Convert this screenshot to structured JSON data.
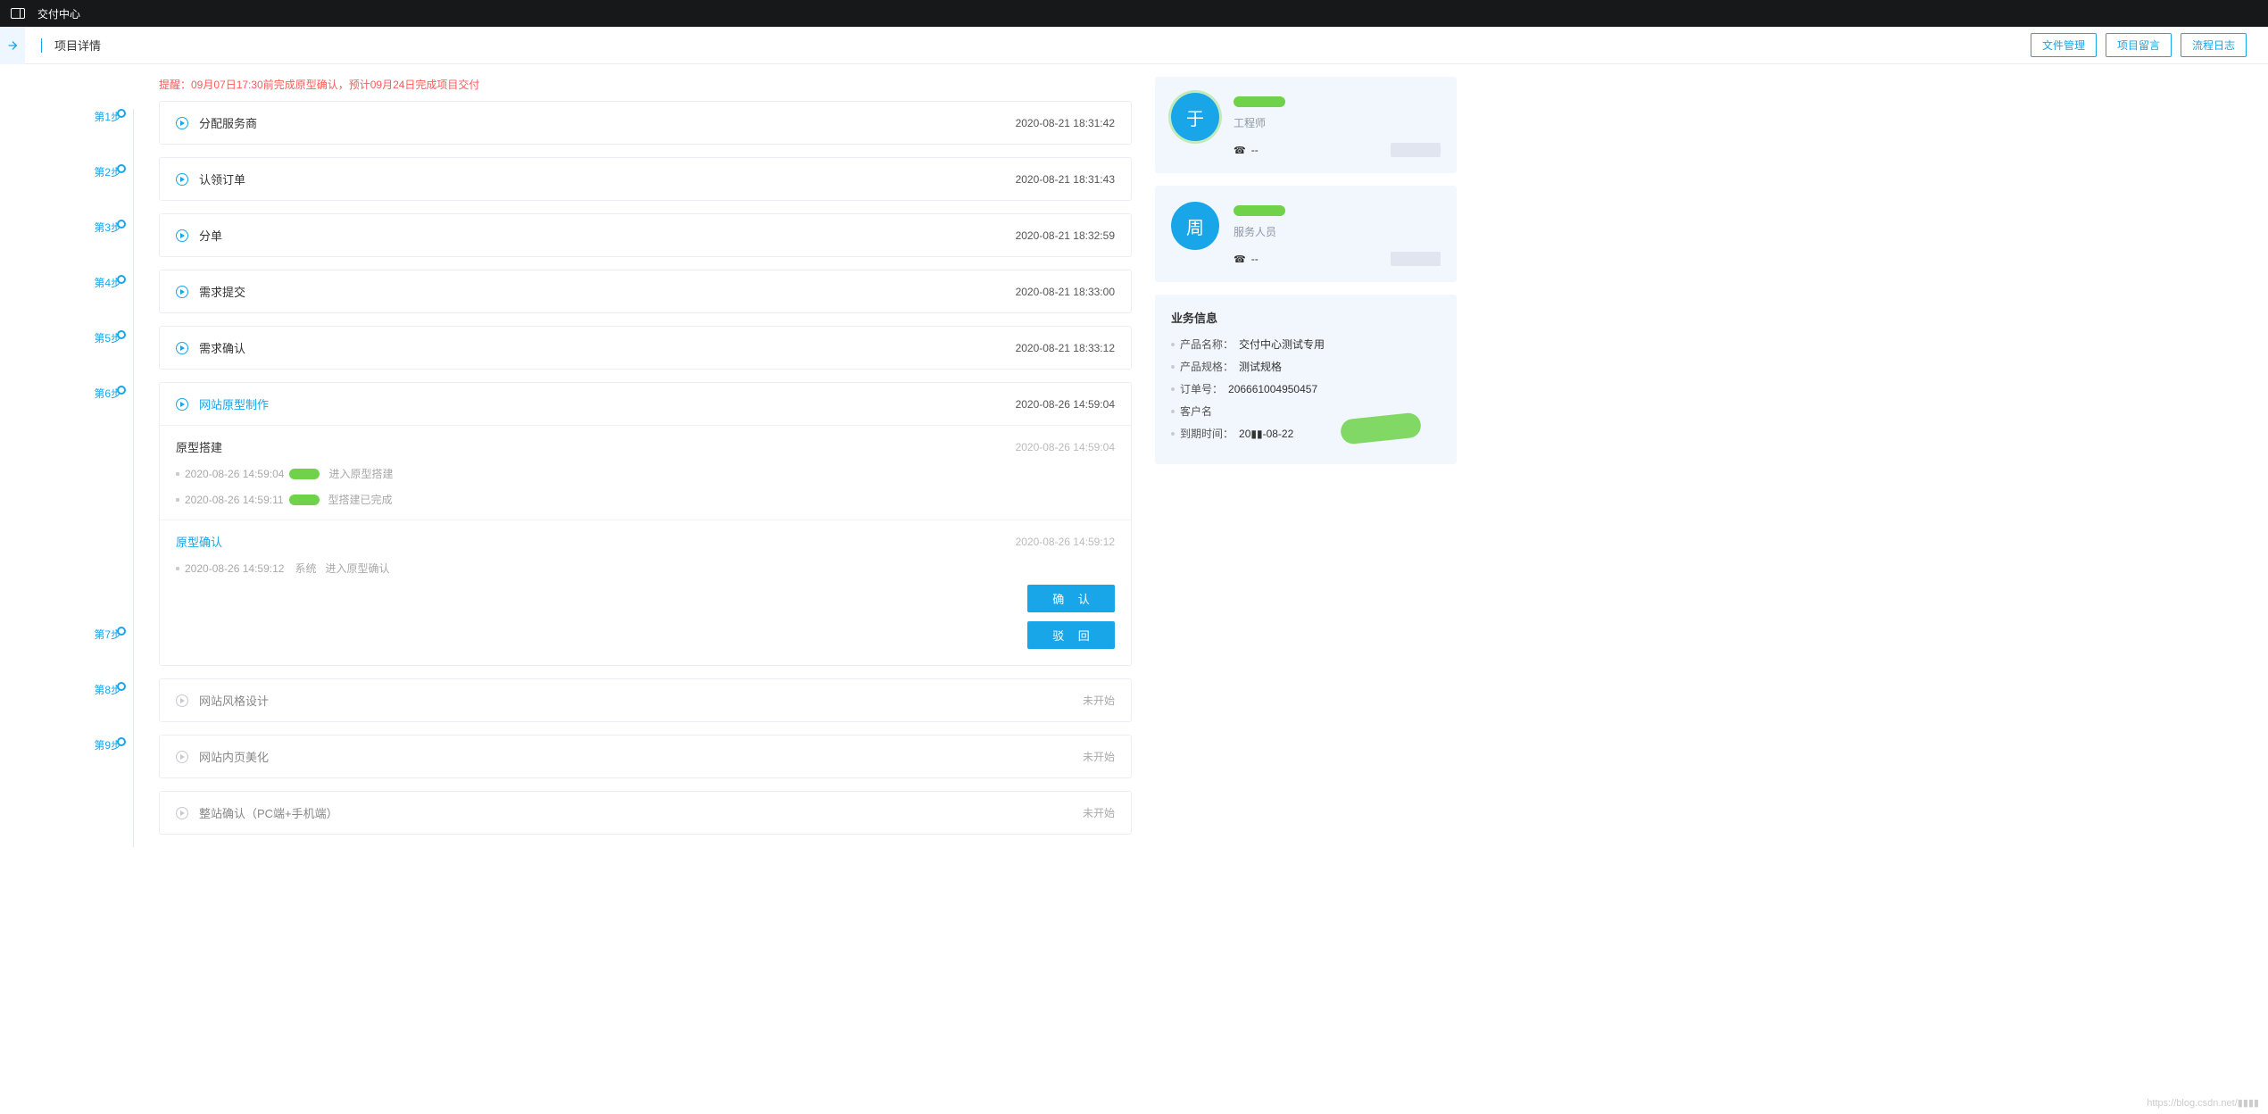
{
  "header": {
    "app_title": "交付中心",
    "page_title": "项目详情"
  },
  "actions": {
    "file_mgmt": "文件管理",
    "project_msg": "项目留言",
    "flow_log": "流程日志"
  },
  "reminder": "提醒：09月07日17:30前完成原型确认，预计09月24日完成项目交付",
  "step_labels": [
    "第1步",
    "第2步",
    "第3步",
    "第4步",
    "第5步",
    "第6步",
    "第7步",
    "第8步",
    "第9步"
  ],
  "steps": [
    {
      "title": "分配服务商",
      "time": "2020-08-21 18:31:42",
      "status": "done"
    },
    {
      "title": "认领订单",
      "time": "2020-08-21 18:31:43",
      "status": "done"
    },
    {
      "title": "分单",
      "time": "2020-08-21 18:32:59",
      "status": "done"
    },
    {
      "title": "需求提交",
      "time": "2020-08-21 18:33:00",
      "status": "done"
    },
    {
      "title": "需求确认",
      "time": "2020-08-21 18:33:12",
      "status": "done"
    },
    {
      "title": "网站原型制作",
      "time": "2020-08-26 14:59:04",
      "status": "active",
      "sections": [
        {
          "title": "原型搭建",
          "time": "2020-08-26 14:59:04",
          "tone": "plain",
          "logs": [
            {
              "time": "2020-08-26 14:59:04",
              "text": "进入原型搭建"
            },
            {
              "time": "2020-08-26 14:59:11",
              "text": "型搭建已完成"
            }
          ]
        },
        {
          "title": "原型确认",
          "time": "2020-08-26 14:59:12",
          "tone": "active",
          "logs": [
            {
              "time": "2020-08-26 14:59:12",
              "actor": "系统",
              "text": "进入原型确认"
            }
          ],
          "buttons": {
            "confirm": "确 认",
            "reject": "驳 回"
          }
        }
      ]
    },
    {
      "title": "网站风格设计",
      "time": "未开始",
      "status": "pending"
    },
    {
      "title": "网站内页美化",
      "time": "未开始",
      "status": "pending"
    },
    {
      "title": "整站确认（PC端+手机端）",
      "time": "未开始",
      "status": "pending"
    }
  ],
  "contacts": [
    {
      "avatar_text": "于",
      "avatar_bg": "#18a6e9",
      "ring": true,
      "role": "工程师",
      "phone_label": "--"
    },
    {
      "avatar_text": "周",
      "avatar_bg": "#18a6e9",
      "ring": false,
      "role": "服务人员",
      "phone_label": "--"
    }
  ],
  "biz": {
    "heading": "业务信息",
    "rows": [
      {
        "label": "产品名称：",
        "value": "交付中心测试专用"
      },
      {
        "label": "产品规格：",
        "value": "测试规格"
      },
      {
        "label": "订单号：",
        "value": "206661004950457"
      },
      {
        "label": "客户名",
        "value": ""
      },
      {
        "label": "到期时间：",
        "value": "20▮▮-08-22"
      }
    ]
  },
  "watermark": "https://blog.csdn.net/▮▮▮▮"
}
